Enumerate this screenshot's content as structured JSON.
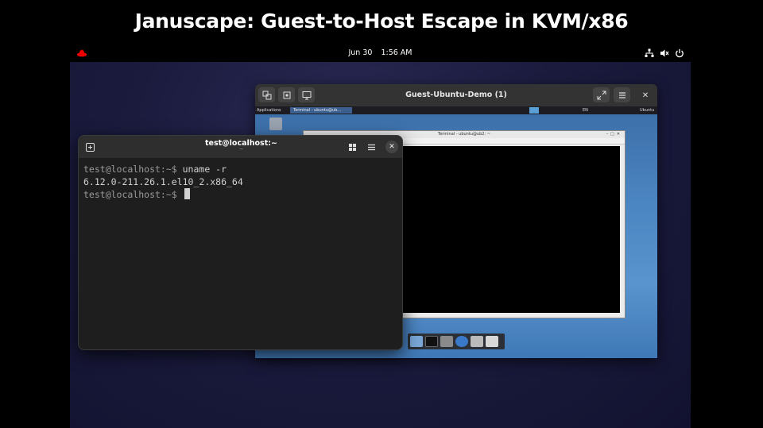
{
  "slide": {
    "title": "Januscape: Guest-to-Host Escape in KVM/x86"
  },
  "topbar": {
    "date": "Jun 30",
    "time": "1:56 AM",
    "logo_icon": "redhat-logo",
    "tray_icons": [
      "network-icon",
      "volume-muted-icon",
      "power-icon"
    ]
  },
  "vm_window": {
    "title": "Guest-Ubuntu-Demo (1)",
    "guest": {
      "panel": {
        "apps_label": "Applications",
        "task_label": "Terminal - ubuntu@ub...",
        "lang": "EN",
        "user": "Ubuntu"
      },
      "terminal_title": "Terminal - ubuntu@ub2: ~"
    }
  },
  "host_terminal": {
    "title": "test@localhost:~",
    "subtitle": "~",
    "lines": [
      {
        "prompt": "test@localhost:~$",
        "command": " uname -r"
      },
      {
        "output": "6.12.0-211.26.1.el10_2.x86_64"
      },
      {
        "prompt": "test@localhost:~$",
        "command": " "
      }
    ]
  },
  "colors": {
    "accent_red": "#ee0000",
    "terminal_bg": "#1e1e1e",
    "guest_blue": "#4c86c2"
  }
}
